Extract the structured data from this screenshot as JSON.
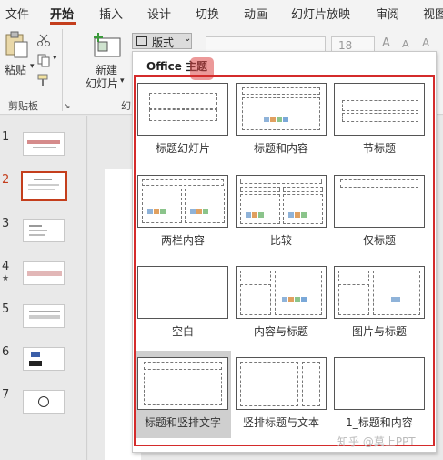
{
  "ribbon_tabs": [
    "文件",
    "开始",
    "插入",
    "设计",
    "切换",
    "动画",
    "幻灯片放映",
    "审阅",
    "视图"
  ],
  "active_tab": "开始",
  "clipboard": {
    "paste_label": "粘贴",
    "group_label": "剪贴板"
  },
  "slides_group": {
    "new_slide_line1": "新建",
    "new_slide_line2": "幻灯片",
    "group_label_partial": "幻"
  },
  "layout_button": {
    "label": "版式"
  },
  "font": {
    "size": "18",
    "grow_label": "A",
    "shrink_label": "A"
  },
  "slide_numbers": [
    "1",
    "2",
    "3",
    "4",
    "5",
    "6",
    "7"
  ],
  "selected_slide": "2",
  "slide4_marker": "★",
  "layout_panel": {
    "title": "Office 主题",
    "layouts": [
      "标题幻灯片",
      "标题和内容",
      "节标题",
      "两栏内容",
      "比较",
      "仅标题",
      "空白",
      "内容与标题",
      "图片与标题",
      "标题和竖排文字",
      "竖排标题与文本",
      "1_标题和内容"
    ],
    "highlighted": "标题和竖排文字"
  },
  "watermark": "知乎 @莫上PPT",
  "colors": {
    "accent": "#c43e1c",
    "highlight_frame": "#d42b2b",
    "hover_cell": "#cfcfcf"
  }
}
